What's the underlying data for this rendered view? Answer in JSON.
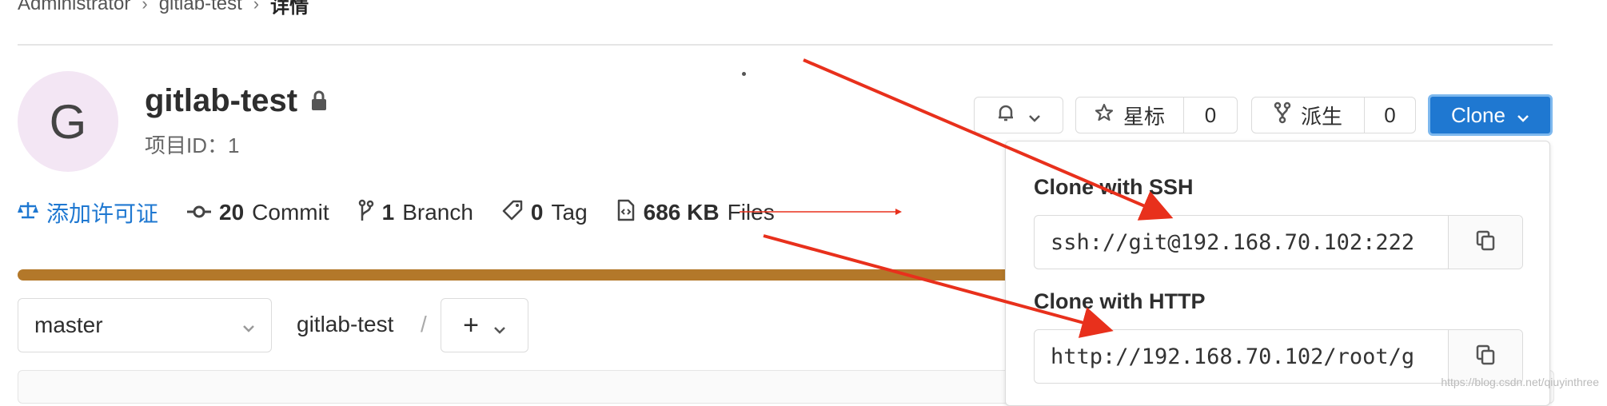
{
  "breadcrumb": {
    "items": [
      "Administrator",
      "gitlab-test"
    ],
    "current": "详情"
  },
  "project": {
    "avatar_letter": "G",
    "name": "gitlab-test",
    "id_label": "项目ID：1"
  },
  "stats": {
    "license": "添加许可证",
    "commits_count": "20",
    "commits_label": "Commit",
    "branches_count": "1",
    "branches_label": "Branch",
    "tags_count": "0",
    "tags_label": "Tag",
    "files_size": "686 KB",
    "files_label": "Files"
  },
  "actions": {
    "star_label": "星标",
    "star_count": "0",
    "fork_label": "派生",
    "fork_count": "0",
    "clone_label": "Clone"
  },
  "branch_bar": {
    "branch": "master",
    "path": "gitlab-test",
    "separator": "/",
    "add": "+"
  },
  "clone_dropdown": {
    "ssh_label": "Clone with SSH",
    "ssh_url": "ssh://git@192.168.70.102:222",
    "http_label": "Clone with HTTP",
    "http_url": "http://192.168.70.102/root/g"
  },
  "watermark": "https://blog.csdn.net/qiuyinthree",
  "colors": {
    "primary": "#1f78d1",
    "language_bar": "#b3782a",
    "annotation_arrow": "#e8301c"
  }
}
